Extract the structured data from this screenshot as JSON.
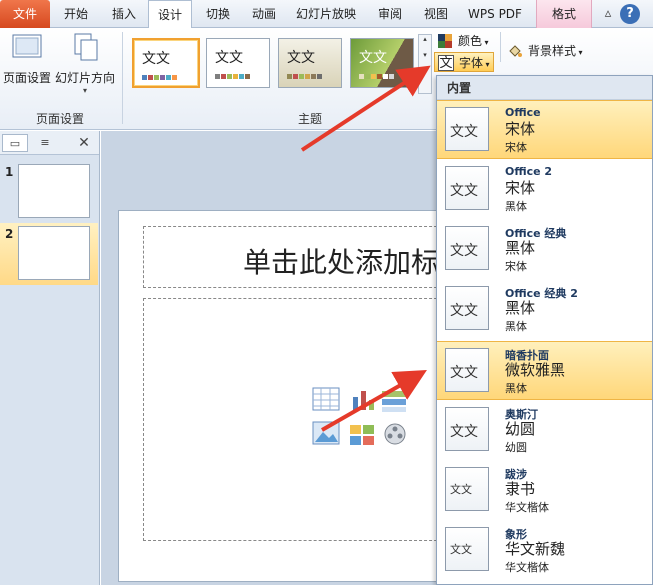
{
  "tabs": [
    "文件",
    "开始",
    "插入",
    "设计",
    "切换",
    "动画",
    "幻灯片放映",
    "审阅",
    "视图",
    "WPS PDF",
    "格式"
  ],
  "ribbon": {
    "page_setup_label": "页面设置",
    "orientation_label": "幻灯片方向",
    "group_page_setup": "页面设置",
    "group_themes": "主题",
    "theme_sample_text": "文文",
    "colors_label": "颜色",
    "fonts_label": "字体",
    "background_label": "背景样式"
  },
  "slides": {
    "numbers": [
      "1",
      "2"
    ],
    "title_placeholder": "单击此处添加标"
  },
  "font_menu": {
    "header": "内置",
    "thumb_text": "文文",
    "items": [
      {
        "name": "Office",
        "heading": "宋体",
        "body": "宋体"
      },
      {
        "name": "Office 2",
        "heading": "宋体",
        "body": "黑体"
      },
      {
        "name": "Office 经典",
        "heading": "黑体",
        "body": "宋体"
      },
      {
        "name": "Office 经典 2",
        "heading": "黑体",
        "body": "黑体"
      },
      {
        "name": "暗香扑面",
        "heading": "微软雅黑",
        "body": "黑体"
      },
      {
        "name": "奥斯汀",
        "heading": "幼圆",
        "body": "幼圆"
      },
      {
        "name": "跋涉",
        "heading": "隶书",
        "body": "华文楷体"
      },
      {
        "name": "象形",
        "heading": "华文新魏",
        "body": "华文楷体"
      }
    ]
  },
  "colors": {
    "accent_highlight": "#ffd77a",
    "file_tab": "#d6491f",
    "arrow": "#e53a2a"
  }
}
